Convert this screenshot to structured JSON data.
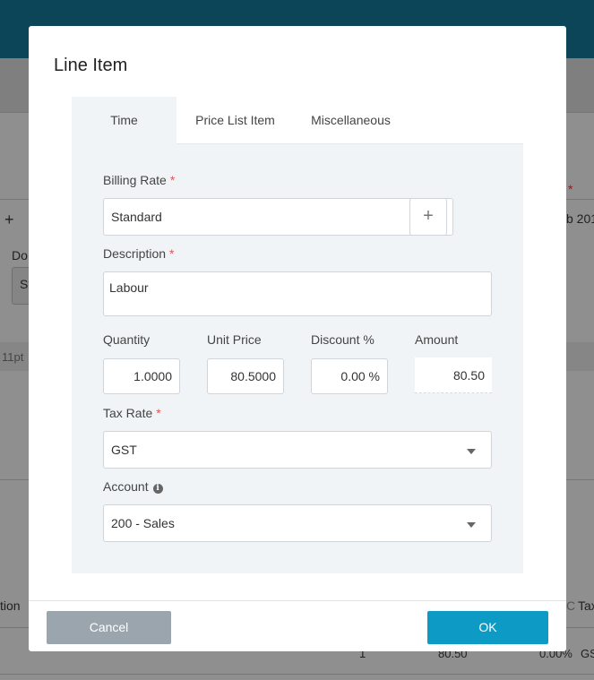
{
  "background": {
    "plus": "+",
    "do_label": "Do",
    "input_fragment": "St",
    "date_fragment": "b 201",
    "asterisk": "*",
    "font_fragment": "11pt",
    "col_description_fragment": "tion",
    "col_tax_fragment": "Tax",
    "col_c_fragment": "C",
    "row_qty": "1",
    "row_amount": "80.50",
    "row_discount": "0.00%",
    "row_tax": "GS"
  },
  "modal": {
    "title": "Line Item",
    "tabs": [
      {
        "label": "Time",
        "active": true
      },
      {
        "label": "Price List Item",
        "active": false
      },
      {
        "label": "Miscellaneous",
        "active": false
      }
    ],
    "required_mark": "*",
    "billing_rate": {
      "label": "Billing Rate",
      "value": "Standard",
      "add_label": "+"
    },
    "description": {
      "label": "Description",
      "value": "Labour"
    },
    "quantity": {
      "label": "Quantity",
      "value": "1.0000"
    },
    "unit_price": {
      "label": "Unit Price",
      "value": "80.5000"
    },
    "discount": {
      "label": "Discount %",
      "value": "0.00 %"
    },
    "amount": {
      "label": "Amount",
      "value": "80.50"
    },
    "tax_rate": {
      "label": "Tax Rate",
      "value": "GST"
    },
    "account": {
      "label": "Account",
      "info_icon": "i",
      "value": "200 - Sales"
    },
    "buttons": {
      "cancel": "Cancel",
      "ok": "OK"
    }
  },
  "colors": {
    "topbar": "#0c4458",
    "ok_button": "#0d9bc5",
    "cancel_button": "#9aa5ae",
    "required": "#e05555",
    "panel": "#f0f4f6"
  },
  "icons": [
    "plus-icon",
    "chevron-down-icon",
    "info-icon"
  ]
}
